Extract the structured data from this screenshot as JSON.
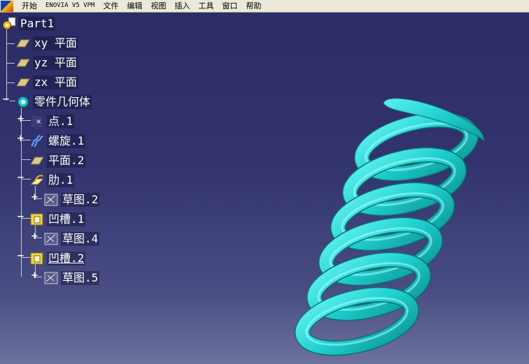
{
  "menu": {
    "items": [
      "开始",
      "ENOVIA V5 VPM",
      "文件",
      "编辑",
      "视图",
      "插入",
      "工具",
      "窗口",
      "帮助"
    ]
  },
  "tree": {
    "root": "Part1",
    "planes": [
      "xy 平面",
      "yz 平面",
      "zx 平面"
    ],
    "body": "零件几何体",
    "features": {
      "point": "点.1",
      "helix": "螺旋.1",
      "plane2": "平面.2",
      "rib": "肋.1",
      "rib_sketch": "草图.2",
      "groove1": "凹槽.1",
      "groove1_sketch": "草图.4",
      "groove2": "凹槽.2",
      "groove2_sketch": "草图.5"
    }
  },
  "colors": {
    "background_top": "#2b2b66",
    "background_bottom": "#6d719c",
    "spring": "#1fcfcf",
    "menubar": "#ece9d8",
    "tree_line": "#c9c9d6"
  },
  "icons": {
    "root": "part-gear-icon",
    "plane": "plane-icon",
    "body": "body-gear-icon",
    "point": "point-icon",
    "helix": "helix-icon",
    "rib": "rib-icon",
    "sketch": "sketch-icon",
    "groove": "groove-icon"
  },
  "viewport": {
    "object": "spring-3d-model"
  }
}
